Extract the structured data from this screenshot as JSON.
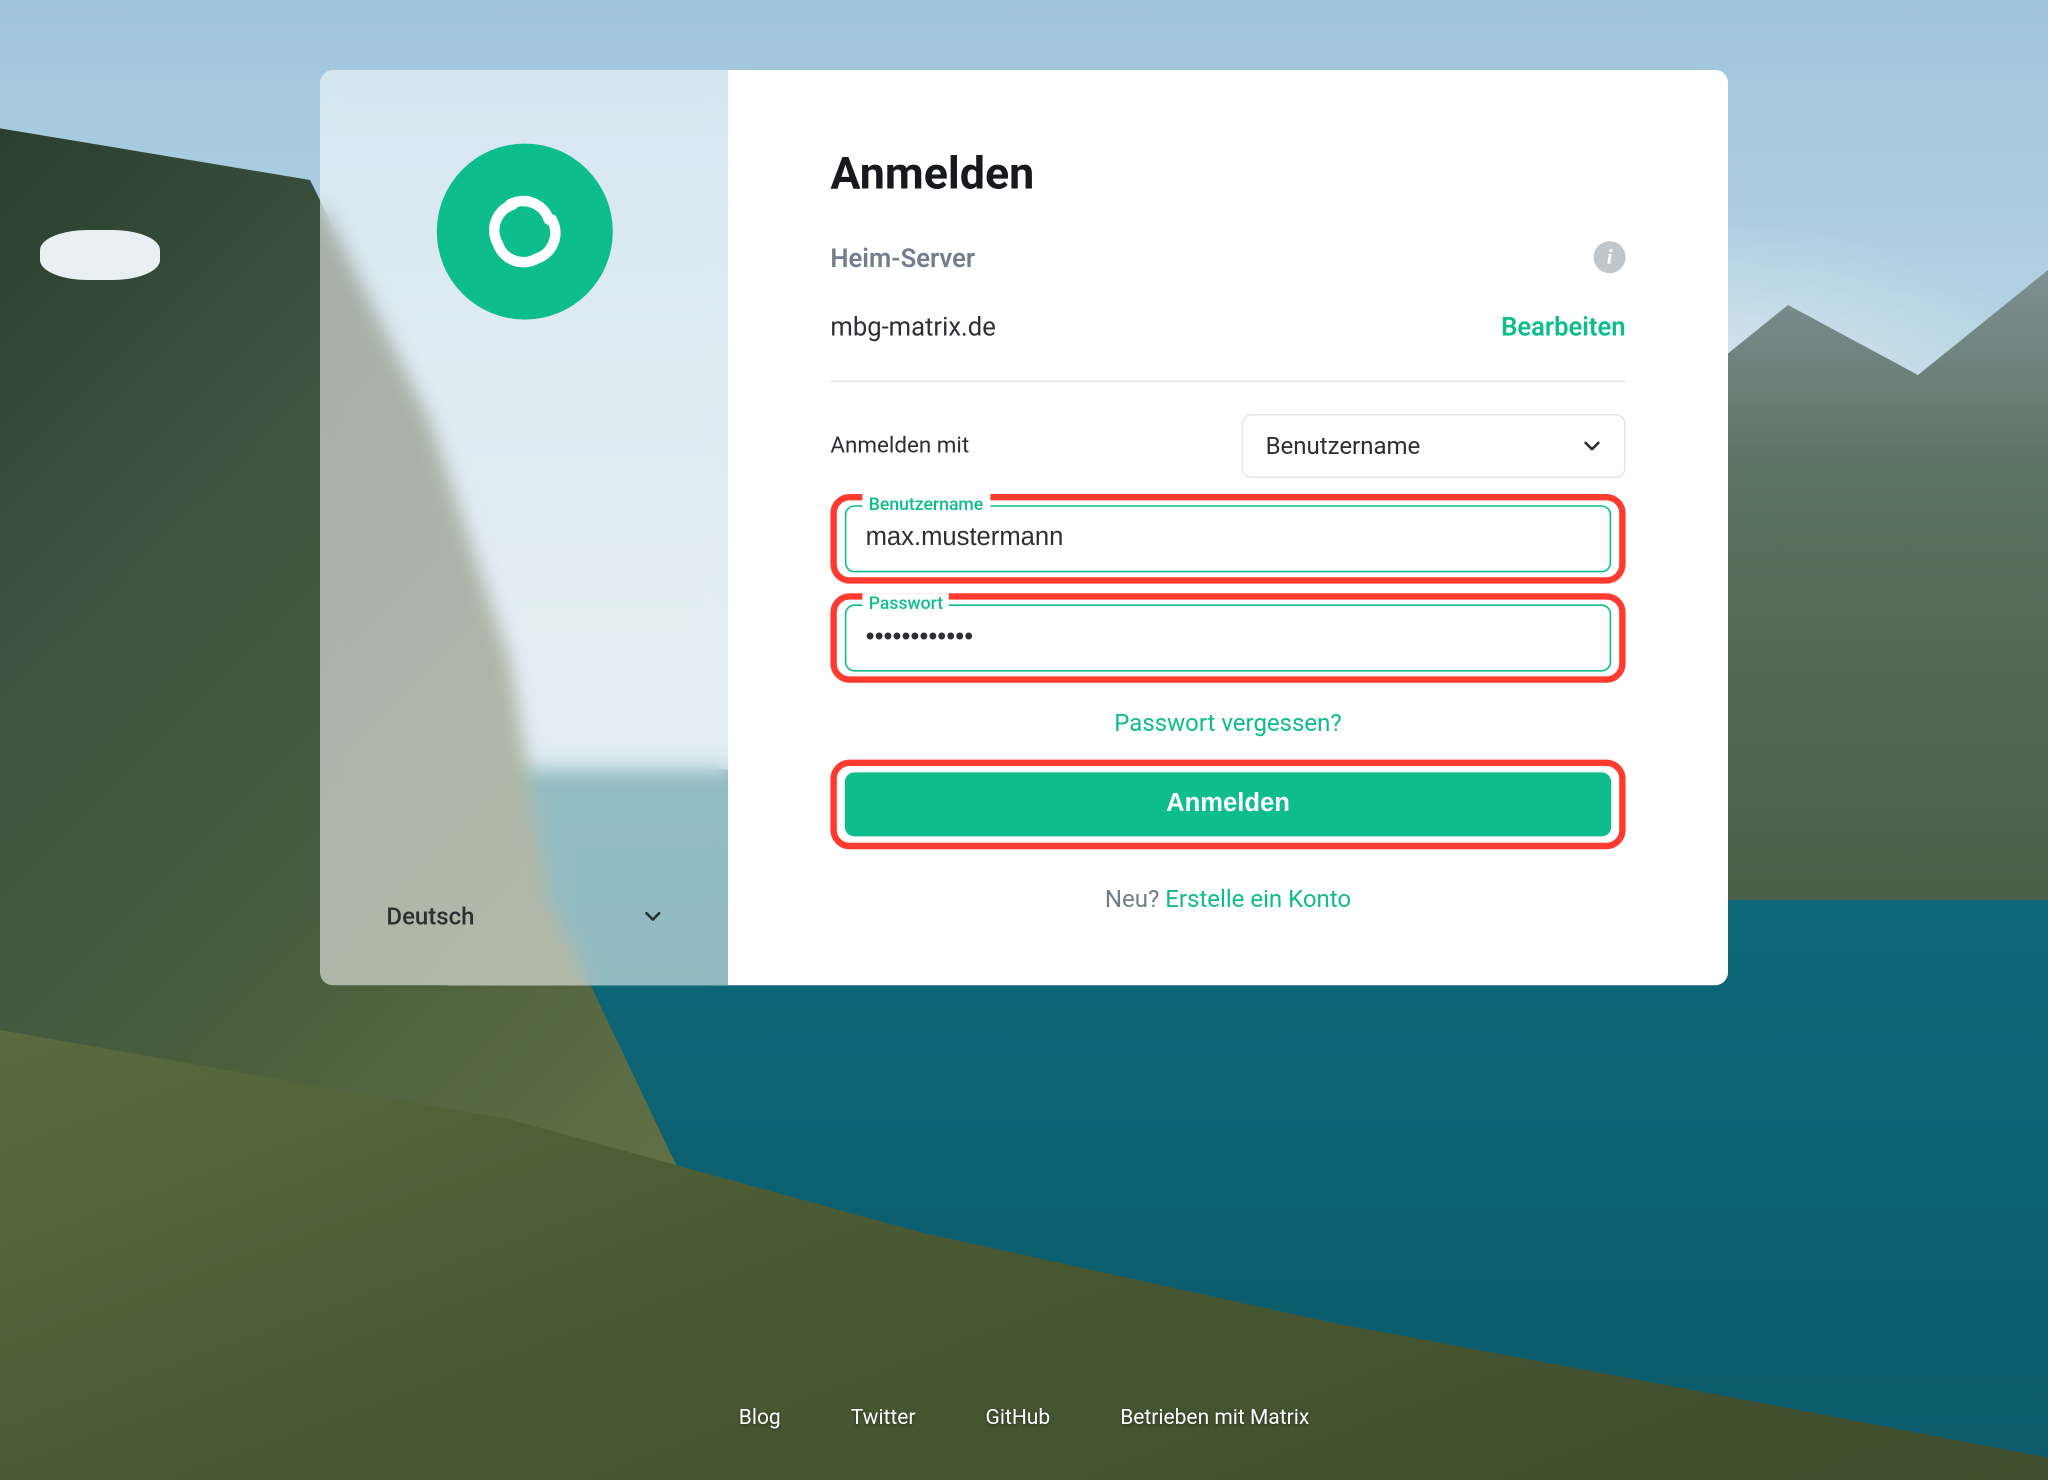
{
  "colors": {
    "accent": "#0dbd8b",
    "highlight": "#ff3b2f"
  },
  "language": {
    "selected": "Deutsch"
  },
  "login": {
    "title": "Anmelden",
    "homeserver_label": "Heim-Server",
    "homeserver_value": "mbg-matrix.de",
    "edit_label": "Bearbeiten",
    "signin_with_label": "Anmelden mit",
    "method_selected": "Benutzername",
    "username_label": "Benutzername",
    "username_value": "max.mustermann",
    "password_label": "Passwort",
    "password_value": "••••••••••••",
    "forgot_password": "Passwort vergessen?",
    "submit_label": "Anmelden",
    "new_prompt": "Neu? ",
    "create_account_label": "Erstelle ein Konto"
  },
  "footer": {
    "items": [
      "Blog",
      "Twitter",
      "GitHub",
      "Betrieben mit Matrix"
    ]
  }
}
